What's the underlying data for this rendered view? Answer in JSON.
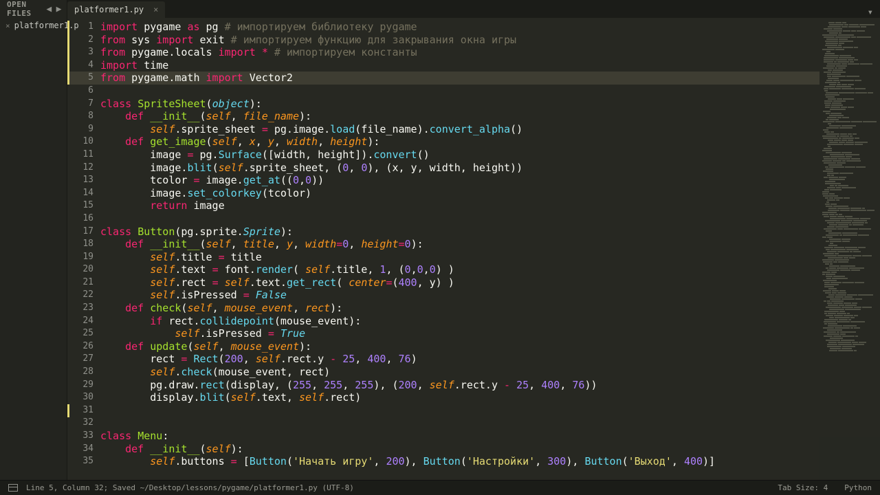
{
  "sidebar": {
    "title": "OPEN FILES",
    "openfile": "platformer1.p"
  },
  "tab": {
    "name": "platformer1.py"
  },
  "tabmenu_icon": "▾",
  "arrows": {
    "left": "◀",
    "right": "▶"
  },
  "status": {
    "left": "Line 5, Column 32; Saved ~/Desktop/lessons/pygame/platformer1.py (UTF-8)",
    "tab": "Tab Size: 4",
    "lang": "Python"
  },
  "code": {
    "l1": [
      [
        "kw",
        "import"
      ],
      [
        "pn",
        " pygame "
      ],
      [
        "kw",
        "as"
      ],
      [
        "pn",
        " pg "
      ],
      [
        "cmt",
        "# импортируем библиотеку pygame"
      ]
    ],
    "l2": [
      [
        "kw",
        "from"
      ],
      [
        "pn",
        " sys "
      ],
      [
        "kw",
        "import"
      ],
      [
        "pn",
        " exit "
      ],
      [
        "cmt",
        "# импортируем функцию для закрывания окна игры"
      ]
    ],
    "l3": [
      [
        "kw",
        "from"
      ],
      [
        "pn",
        " pygame.locals "
      ],
      [
        "kw",
        "import"
      ],
      [
        "pn",
        " "
      ],
      [
        "op",
        "*"
      ],
      [
        "pn",
        " "
      ],
      [
        "cmt",
        "# импортируем константы"
      ]
    ],
    "l4": [
      [
        "kw",
        "import"
      ],
      [
        "pn",
        " time"
      ]
    ],
    "l5": [
      [
        "kw",
        "from"
      ],
      [
        "pn",
        " pygame.math "
      ],
      [
        "kw",
        "import"
      ],
      [
        "pn",
        " Vector2"
      ]
    ],
    "l6": [
      [
        "pn",
        ""
      ]
    ],
    "l7": [
      [
        "kw",
        "class"
      ],
      [
        "pn",
        " "
      ],
      [
        "fndef",
        "SpriteSheet"
      ],
      [
        "pn",
        "("
      ],
      [
        "kw2",
        "object"
      ],
      [
        "pn",
        "):"
      ]
    ],
    "l8": [
      [
        "pn",
        "    "
      ],
      [
        "kw",
        "def"
      ],
      [
        "pn",
        " "
      ],
      [
        "fndef",
        "__init__"
      ],
      [
        "pn",
        "("
      ],
      [
        "prm",
        "self"
      ],
      [
        "pn",
        ", "
      ],
      [
        "prm",
        "file_name"
      ],
      [
        "pn",
        "):"
      ]
    ],
    "l9": [
      [
        "pn",
        "        "
      ],
      [
        "prm",
        "self"
      ],
      [
        "pn",
        ".sprite_sheet "
      ],
      [
        "op",
        "="
      ],
      [
        "pn",
        " pg.image."
      ],
      [
        "fn",
        "load"
      ],
      [
        "pn",
        "(file_name)."
      ],
      [
        "fn",
        "convert_alpha"
      ],
      [
        "pn",
        "()"
      ]
    ],
    "l10": [
      [
        "pn",
        "    "
      ],
      [
        "kw",
        "def"
      ],
      [
        "pn",
        " "
      ],
      [
        "fndef",
        "get_image"
      ],
      [
        "pn",
        "("
      ],
      [
        "prm",
        "self"
      ],
      [
        "pn",
        ", "
      ],
      [
        "prm",
        "x"
      ],
      [
        "pn",
        ", "
      ],
      [
        "prm",
        "y"
      ],
      [
        "pn",
        ", "
      ],
      [
        "prm",
        "width"
      ],
      [
        "pn",
        ", "
      ],
      [
        "prm",
        "height"
      ],
      [
        "pn",
        "):"
      ]
    ],
    "l11": [
      [
        "pn",
        "        image "
      ],
      [
        "op",
        "="
      ],
      [
        "pn",
        " pg."
      ],
      [
        "fn",
        "Surface"
      ],
      [
        "pn",
        "([width, height])."
      ],
      [
        "fn",
        "convert"
      ],
      [
        "pn",
        "()"
      ]
    ],
    "l12": [
      [
        "pn",
        "        image."
      ],
      [
        "fn",
        "blit"
      ],
      [
        "pn",
        "("
      ],
      [
        "prm",
        "self"
      ],
      [
        "pn",
        ".sprite_sheet, ("
      ],
      [
        "num",
        "0"
      ],
      [
        "pn",
        ", "
      ],
      [
        "num",
        "0"
      ],
      [
        "pn",
        "), (x, y, width, height))"
      ]
    ],
    "l13": [
      [
        "pn",
        "        tcolor "
      ],
      [
        "op",
        "="
      ],
      [
        "pn",
        " image."
      ],
      [
        "fn",
        "get_at"
      ],
      [
        "pn",
        "(("
      ],
      [
        "num",
        "0"
      ],
      [
        "pn",
        ","
      ],
      [
        "num",
        "0"
      ],
      [
        "pn",
        "))"
      ]
    ],
    "l14": [
      [
        "pn",
        "        image."
      ],
      [
        "fn",
        "set_colorkey"
      ],
      [
        "pn",
        "(tcolor)"
      ]
    ],
    "l15": [
      [
        "pn",
        "        "
      ],
      [
        "kw",
        "return"
      ],
      [
        "pn",
        " image"
      ]
    ],
    "l16": [
      [
        "pn",
        ""
      ]
    ],
    "l17": [
      [
        "kw",
        "class"
      ],
      [
        "pn",
        " "
      ],
      [
        "fndef",
        "Button"
      ],
      [
        "pn",
        "(pg.sprite."
      ],
      [
        "kw2",
        "Sprite"
      ],
      [
        "pn",
        "):"
      ]
    ],
    "l18": [
      [
        "pn",
        "    "
      ],
      [
        "kw",
        "def"
      ],
      [
        "pn",
        " "
      ],
      [
        "fndef",
        "__init__"
      ],
      [
        "pn",
        "("
      ],
      [
        "prm",
        "self"
      ],
      [
        "pn",
        ", "
      ],
      [
        "prm",
        "title"
      ],
      [
        "pn",
        ", "
      ],
      [
        "prm",
        "y"
      ],
      [
        "pn",
        ", "
      ],
      [
        "prm",
        "width"
      ],
      [
        "op",
        "="
      ],
      [
        "num",
        "0"
      ],
      [
        "pn",
        ", "
      ],
      [
        "prm",
        "height"
      ],
      [
        "op",
        "="
      ],
      [
        "num",
        "0"
      ],
      [
        "pn",
        "):"
      ]
    ],
    "l19": [
      [
        "pn",
        "        "
      ],
      [
        "prm",
        "self"
      ],
      [
        "pn",
        ".title "
      ],
      [
        "op",
        "="
      ],
      [
        "pn",
        " title"
      ]
    ],
    "l20": [
      [
        "pn",
        "        "
      ],
      [
        "prm",
        "self"
      ],
      [
        "pn",
        ".text "
      ],
      [
        "op",
        "="
      ],
      [
        "pn",
        " font."
      ],
      [
        "fn",
        "render"
      ],
      [
        "pn",
        "( "
      ],
      [
        "prm",
        "self"
      ],
      [
        "pn",
        ".title, "
      ],
      [
        "num",
        "1"
      ],
      [
        "pn",
        ", ("
      ],
      [
        "num",
        "0"
      ],
      [
        "pn",
        ","
      ],
      [
        "num",
        "0"
      ],
      [
        "pn",
        ","
      ],
      [
        "num",
        "0"
      ],
      [
        "pn",
        ") )"
      ]
    ],
    "l21": [
      [
        "pn",
        "        "
      ],
      [
        "prm",
        "self"
      ],
      [
        "pn",
        ".rect "
      ],
      [
        "op",
        "="
      ],
      [
        "pn",
        " "
      ],
      [
        "prm",
        "self"
      ],
      [
        "pn",
        ".text."
      ],
      [
        "fn",
        "get_rect"
      ],
      [
        "pn",
        "( "
      ],
      [
        "prm",
        "center"
      ],
      [
        "op",
        "="
      ],
      [
        "pn",
        "("
      ],
      [
        "num",
        "400"
      ],
      [
        "pn",
        ", y) )"
      ]
    ],
    "l22": [
      [
        "pn",
        "        "
      ],
      [
        "prm",
        "self"
      ],
      [
        "pn",
        ".isPressed "
      ],
      [
        "op",
        "="
      ],
      [
        "pn",
        " "
      ],
      [
        "kw2",
        "False"
      ]
    ],
    "l23": [
      [
        "pn",
        "    "
      ],
      [
        "kw",
        "def"
      ],
      [
        "pn",
        " "
      ],
      [
        "fndef",
        "check"
      ],
      [
        "pn",
        "("
      ],
      [
        "prm",
        "self"
      ],
      [
        "pn",
        ", "
      ],
      [
        "prm",
        "mouse_event"
      ],
      [
        "pn",
        ", "
      ],
      [
        "prm",
        "rect"
      ],
      [
        "pn",
        "):"
      ]
    ],
    "l24": [
      [
        "pn",
        "        "
      ],
      [
        "kw",
        "if"
      ],
      [
        "pn",
        " rect."
      ],
      [
        "fn",
        "collidepoint"
      ],
      [
        "pn",
        "(mouse_event):"
      ]
    ],
    "l25": [
      [
        "pn",
        "            "
      ],
      [
        "prm",
        "self"
      ],
      [
        "pn",
        ".isPressed "
      ],
      [
        "op",
        "="
      ],
      [
        "pn",
        " "
      ],
      [
        "kw2",
        "True"
      ]
    ],
    "l26": [
      [
        "pn",
        "    "
      ],
      [
        "kw",
        "def"
      ],
      [
        "pn",
        " "
      ],
      [
        "fndef",
        "update"
      ],
      [
        "pn",
        "("
      ],
      [
        "prm",
        "self"
      ],
      [
        "pn",
        ", "
      ],
      [
        "prm",
        "mouse_event"
      ],
      [
        "pn",
        "):"
      ]
    ],
    "l27": [
      [
        "pn",
        "        rect "
      ],
      [
        "op",
        "="
      ],
      [
        "pn",
        " "
      ],
      [
        "fn",
        "Rect"
      ],
      [
        "pn",
        "("
      ],
      [
        "num",
        "200"
      ],
      [
        "pn",
        ", "
      ],
      [
        "prm",
        "self"
      ],
      [
        "pn",
        ".rect.y "
      ],
      [
        "op",
        "-"
      ],
      [
        "pn",
        " "
      ],
      [
        "num",
        "25"
      ],
      [
        "pn",
        ", "
      ],
      [
        "num",
        "400"
      ],
      [
        "pn",
        ", "
      ],
      [
        "num",
        "76"
      ],
      [
        "pn",
        ")"
      ]
    ],
    "l28": [
      [
        "pn",
        "        "
      ],
      [
        "prm",
        "self"
      ],
      [
        "pn",
        "."
      ],
      [
        "fn",
        "check"
      ],
      [
        "pn",
        "(mouse_event, rect)"
      ]
    ],
    "l29": [
      [
        "pn",
        "        pg.draw."
      ],
      [
        "fn",
        "rect"
      ],
      [
        "pn",
        "(display, ("
      ],
      [
        "num",
        "255"
      ],
      [
        "pn",
        ", "
      ],
      [
        "num",
        "255"
      ],
      [
        "pn",
        ", "
      ],
      [
        "num",
        "255"
      ],
      [
        "pn",
        "), ("
      ],
      [
        "num",
        "200"
      ],
      [
        "pn",
        ", "
      ],
      [
        "prm",
        "self"
      ],
      [
        "pn",
        ".rect.y "
      ],
      [
        "op",
        "-"
      ],
      [
        "pn",
        " "
      ],
      [
        "num",
        "25"
      ],
      [
        "pn",
        ", "
      ],
      [
        "num",
        "400"
      ],
      [
        "pn",
        ", "
      ],
      [
        "num",
        "76"
      ],
      [
        "pn",
        "))"
      ]
    ],
    "l30": [
      [
        "pn",
        "        display."
      ],
      [
        "fn",
        "blit"
      ],
      [
        "pn",
        "("
      ],
      [
        "prm",
        "self"
      ],
      [
        "pn",
        ".text, "
      ],
      [
        "prm",
        "self"
      ],
      [
        "pn",
        ".rect)"
      ]
    ],
    "l31": [
      [
        "pn",
        ""
      ]
    ],
    "l32": [
      [
        "pn",
        ""
      ]
    ],
    "l33": [
      [
        "kw",
        "class"
      ],
      [
        "pn",
        " "
      ],
      [
        "fndef",
        "Menu"
      ],
      [
        "pn",
        ":"
      ]
    ],
    "l34": [
      [
        "pn",
        "    "
      ],
      [
        "kw",
        "def"
      ],
      [
        "pn",
        " "
      ],
      [
        "fndef",
        "__init__"
      ],
      [
        "pn",
        "("
      ],
      [
        "prm",
        "self"
      ],
      [
        "pn",
        "):"
      ]
    ],
    "l35": [
      [
        "pn",
        "        "
      ],
      [
        "prm",
        "self"
      ],
      [
        "pn",
        ".buttons "
      ],
      [
        "op",
        "="
      ],
      [
        "pn",
        " ["
      ],
      [
        "fn",
        "Button"
      ],
      [
        "pn",
        "("
      ],
      [
        "str",
        "'Начать игру'"
      ],
      [
        "pn",
        ", "
      ],
      [
        "num",
        "200"
      ],
      [
        "pn",
        "), "
      ],
      [
        "fn",
        "Button"
      ],
      [
        "pn",
        "("
      ],
      [
        "str",
        "'Настройки'"
      ],
      [
        "pn",
        ", "
      ],
      [
        "num",
        "300"
      ],
      [
        "pn",
        "), "
      ],
      [
        "fn",
        "Button"
      ],
      [
        "pn",
        "("
      ],
      [
        "str",
        "'Выход'"
      ],
      [
        "pn",
        ", "
      ],
      [
        "num",
        "400"
      ],
      [
        "pn",
        ")]"
      ]
    ]
  },
  "highlight_line": 5,
  "modified_markers": [
    [
      1,
      5
    ],
    [
      31,
      31
    ]
  ]
}
